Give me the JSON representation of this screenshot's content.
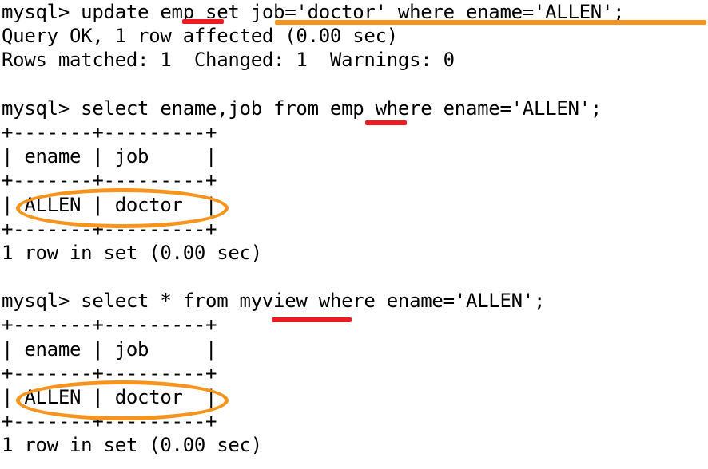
{
  "terminal": {
    "title": "mysql-client-console",
    "background_color": "#ffffff",
    "text_color": "#000000",
    "annotation_colors": {
      "red": "#ed1c24",
      "orange": "#f7941e"
    },
    "lines": [
      {
        "id": "l1",
        "text": "mysql> update emp set job='doctor' where ename='ALLEN';"
      },
      {
        "id": "l2",
        "text": "Query OK, 1 row affected (0.00 sec)"
      },
      {
        "id": "l3",
        "text": "Rows matched: 1  Changed: 1  Warnings: 0"
      },
      {
        "id": "l4",
        "text": ""
      },
      {
        "id": "l5",
        "text": "mysql> select ename,job from emp where ename='ALLEN';"
      },
      {
        "id": "l6",
        "text": "+-------+---------+"
      },
      {
        "id": "l7",
        "text": "| ename | job     |"
      },
      {
        "id": "l8",
        "text": "+-------+---------+"
      },
      {
        "id": "l9",
        "text": "| ALLEN | doctor  |"
      },
      {
        "id": "l10",
        "text": "+-------+---------+"
      },
      {
        "id": "l11",
        "text": "1 row in set (0.00 sec)"
      },
      {
        "id": "l12",
        "text": ""
      },
      {
        "id": "l13",
        "text": "mysql> select * from myview where ename='ALLEN';"
      },
      {
        "id": "l14",
        "text": "+-------+---------+"
      },
      {
        "id": "l15",
        "text": "| ename | job     |"
      },
      {
        "id": "l16",
        "text": "+-------+---------+"
      },
      {
        "id": "l17",
        "text": "| ALLEN | doctor  |"
      },
      {
        "id": "l18",
        "text": "+-------+---------+"
      },
      {
        "id": "l19",
        "text": "1 row in set (0.00 sec)"
      }
    ],
    "statements": [
      {
        "prompt": "mysql>",
        "sql": "update emp set job='doctor' where ename='ALLEN';",
        "result_status": "Query OK, 1 row affected (0.00 sec)",
        "result_detail": "Rows matched: 1  Changed: 1  Warnings: 0"
      },
      {
        "prompt": "mysql>",
        "sql": "select ename,job from emp where ename='ALLEN';",
        "result_status": "1 row in set (0.00 sec)"
      },
      {
        "prompt": "mysql>",
        "sql": "select * from myview where ename='ALLEN';",
        "result_status": "1 row in set (0.00 sec)"
      }
    ],
    "result_tables": [
      {
        "columns": [
          "ename",
          "job"
        ],
        "rows": [
          [
            "ALLEN",
            "doctor"
          ]
        ]
      },
      {
        "columns": [
          "ename",
          "job"
        ],
        "rows": [
          [
            "ALLEN",
            "doctor"
          ]
        ]
      }
    ],
    "annotations": [
      {
        "kind": "underline",
        "color": "red",
        "target_text": "emp",
        "line_id": "l1"
      },
      {
        "kind": "underline",
        "color": "orange",
        "target_text": "job='doctor' where ename='ALLEN';",
        "line_id": "l1"
      },
      {
        "kind": "underline",
        "color": "red",
        "target_text": "emp",
        "line_id": "l5"
      },
      {
        "kind": "ellipse",
        "color": "orange",
        "target_text": "ALLEN | doctor",
        "line_id": "l9"
      },
      {
        "kind": "underline",
        "color": "red",
        "target_text": "myview",
        "line_id": "l13"
      },
      {
        "kind": "ellipse",
        "color": "orange",
        "target_text": "ALLEN | doctor",
        "line_id": "l17"
      }
    ]
  }
}
